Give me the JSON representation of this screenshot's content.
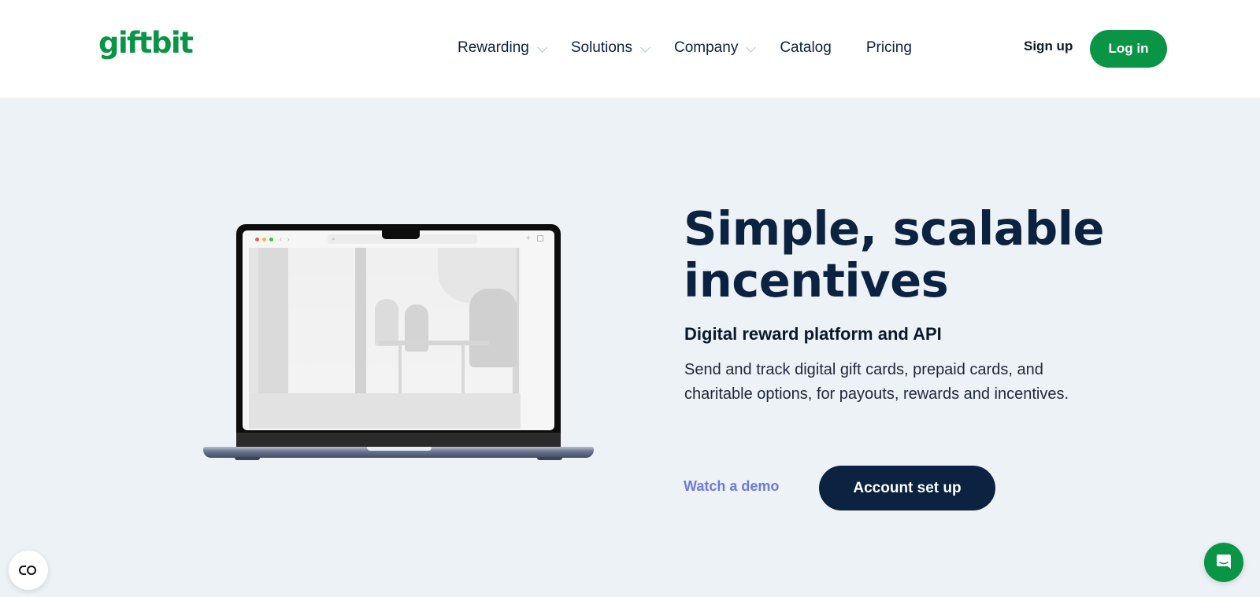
{
  "header": {
    "logo": "giftbit",
    "nav": [
      {
        "label": "Rewarding",
        "has_dropdown": true
      },
      {
        "label": "Solutions",
        "has_dropdown": true
      },
      {
        "label": "Company",
        "has_dropdown": true
      },
      {
        "label": "Catalog",
        "has_dropdown": false
      },
      {
        "label": "Pricing",
        "has_dropdown": false
      }
    ],
    "signup_label": "Sign up",
    "login_label": "Log in"
  },
  "hero": {
    "title_line1": "Simple, scalable",
    "title_line2": "incentives",
    "subtitle": "Digital reward platform and API",
    "description": "Send and track digital gift cards, prepaid cards, and charitable options, for payouts, rewards and incentives.",
    "watch_demo_label": "Watch a demo",
    "account_setup_label": "Account set up"
  },
  "laptop_browser": {
    "back_icon": "‹",
    "forward_icon": "›",
    "search_icon": "⌕",
    "new_tab_icon": "+"
  },
  "floating": {
    "consent_icon": "cookie-consent-icon",
    "chat_icon": "chat-icon"
  },
  "colors": {
    "brand_green": "#0a9446",
    "navy": "#0b2240",
    "link_purple": "#6c7bdc",
    "background": "#edf2f7"
  }
}
